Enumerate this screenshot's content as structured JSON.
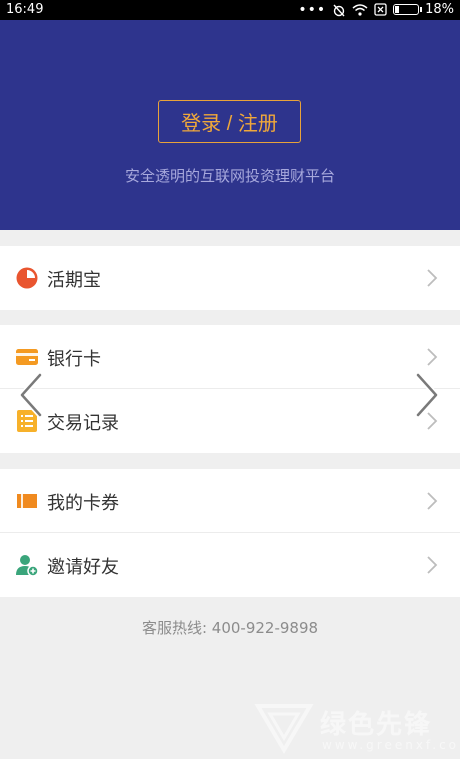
{
  "status_bar": {
    "time": "16:49",
    "battery": "18%",
    "battery_level": 0.18
  },
  "hero": {
    "login_label": "登录 / 注册",
    "slogan": "安全透明的互联网投资理财平台",
    "bg_color": "#2e348d",
    "accent_color": "#f0a83a"
  },
  "menu_groups": [
    {
      "items": [
        {
          "label": "活期宝",
          "icon": "pie-chart-icon",
          "icon_color": "#e9552f"
        }
      ]
    },
    {
      "items": [
        {
          "label": "银行卡",
          "icon": "bank-card-icon",
          "icon_color": "#f49a22"
        },
        {
          "label": "交易记录",
          "icon": "list-icon",
          "icon_color": "#f7b12a"
        }
      ]
    },
    {
      "items": [
        {
          "label": "我的卡券",
          "icon": "coupon-icon",
          "icon_color": "#f08a1f"
        },
        {
          "label": "邀请好友",
          "icon": "add-friend-icon",
          "icon_color": "#3aa57b"
        }
      ]
    }
  ],
  "footer": {
    "hotline": "客服热线: 400-922-9898"
  },
  "watermark": {
    "text": "绿色先锋",
    "sub": "www.greenxf.com"
  }
}
